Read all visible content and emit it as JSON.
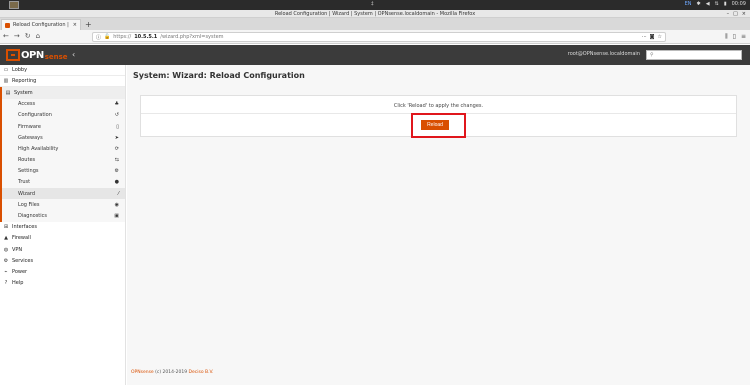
{
  "os_panel": {
    "center_glyph": "‡",
    "lang": "EN",
    "clock": "00:09"
  },
  "window": {
    "title": "Reload Configuration | Wizard | System | OPNsense.localdomain - Mozilla Firefox"
  },
  "tab": {
    "label": "Reload Configuration | Wiz",
    "close": "×",
    "new_tab": "+"
  },
  "url": {
    "protocol": "https://",
    "host": "10.5.5.1",
    "path": "/wizard.php?xml=system"
  },
  "header": {
    "logo_main": "OPN",
    "logo_sub": "sense",
    "collapse_glyph": "‹",
    "user": "root@OPNsense.localdomain"
  },
  "sidebar": {
    "items_top": [
      {
        "label": "Lobby",
        "icon": "laptop-icon"
      },
      {
        "label": "Reporting",
        "icon": "chart-icon"
      },
      {
        "label": "System",
        "icon": "server-icon"
      }
    ],
    "system_sub": [
      {
        "label": "Access",
        "icon": "users-icon"
      },
      {
        "label": "Configuration",
        "icon": "history-icon"
      },
      {
        "label": "Firmware",
        "icon": "file-icon"
      },
      {
        "label": "Gateways",
        "icon": "location-arrow-icon"
      },
      {
        "label": "High Availability",
        "icon": "refresh-icon"
      },
      {
        "label": "Routes",
        "icon": "map-signs-icon"
      },
      {
        "label": "Settings",
        "icon": "cogs-icon"
      },
      {
        "label": "Trust",
        "icon": "certificate-icon"
      },
      {
        "label": "Wizard",
        "icon": "magic-icon"
      },
      {
        "label": "Log Files",
        "icon": "eye-icon"
      },
      {
        "label": "Diagnostics",
        "icon": "medkit-icon"
      }
    ],
    "items_bottom": [
      {
        "label": "Interfaces",
        "icon": "sitemap-icon"
      },
      {
        "label": "Firewall",
        "icon": "fire-icon"
      },
      {
        "label": "VPN",
        "icon": "globe-icon"
      },
      {
        "label": "Services",
        "icon": "cog-icon"
      },
      {
        "label": "Power",
        "icon": "plug-icon"
      },
      {
        "label": "Help",
        "icon": "question-icon"
      }
    ]
  },
  "main": {
    "title": "System: Wizard: Reload Configuration",
    "message": "Click 'Reload' to apply the changes.",
    "reload_label": "Reload"
  },
  "footer": {
    "brand": "OPNsense",
    "copyright": " (c) 2014-2019 ",
    "company": "Deciso B.V."
  },
  "colors": {
    "accent": "#d94f00",
    "highlight": "#e0161c",
    "header_bg": "#3b3b3b"
  }
}
